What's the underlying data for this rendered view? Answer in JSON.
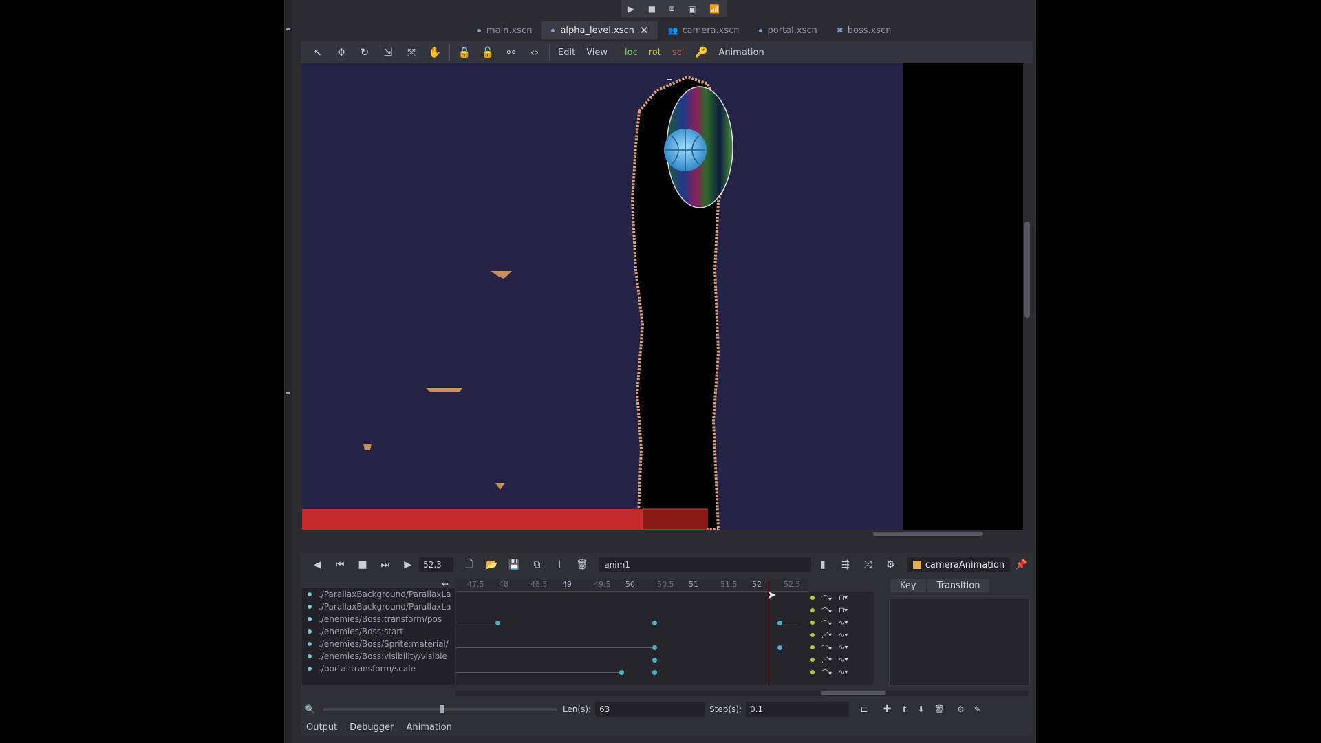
{
  "play_controls": [
    "▶",
    "■",
    "⧈",
    "▣",
    "📶"
  ],
  "scene_tabs": [
    {
      "label": "main.xscn",
      "icon": "dot"
    },
    {
      "label": "alpha_level.xscn",
      "icon": "dot",
      "active": true,
      "close": "✕"
    },
    {
      "label": "camera.xscn",
      "icon": "people"
    },
    {
      "label": "portal.xscn",
      "icon": "dot"
    },
    {
      "label": "boss.xscn",
      "icon": "bone"
    }
  ],
  "viewport_toolbar": {
    "menus": [
      "Edit",
      "View"
    ],
    "loc": "loc",
    "rot": "rot",
    "scl": "scl",
    "animation": "Animation"
  },
  "animation": {
    "time": "52.3",
    "name": "anim1",
    "player": "cameraAnimation",
    "ruler": [
      "47.5",
      "48",
      "48.5",
      "49",
      "49.5",
      "50",
      "50.5",
      "51",
      "51.5",
      "52",
      "52.5"
    ],
    "tracks": [
      "./ParallaxBackground/ParallaxLa",
      "./ParallaxBackground/ParallaxLa",
      "./enemies/Boss:transform/pos",
      "./enemies/Boss:start",
      "./enemies/Boss/Sprite:material/",
      "./enemies/Boss:visibility/visible",
      "./portal:transform/scale"
    ],
    "key_tab": "Key",
    "transition_tab": "Transition",
    "len_label": "Len(s):",
    "len_value": "63",
    "step_label": "Step(s):",
    "step_value": "0.1"
  },
  "dock": [
    "Output",
    "Debugger",
    "Animation"
  ]
}
